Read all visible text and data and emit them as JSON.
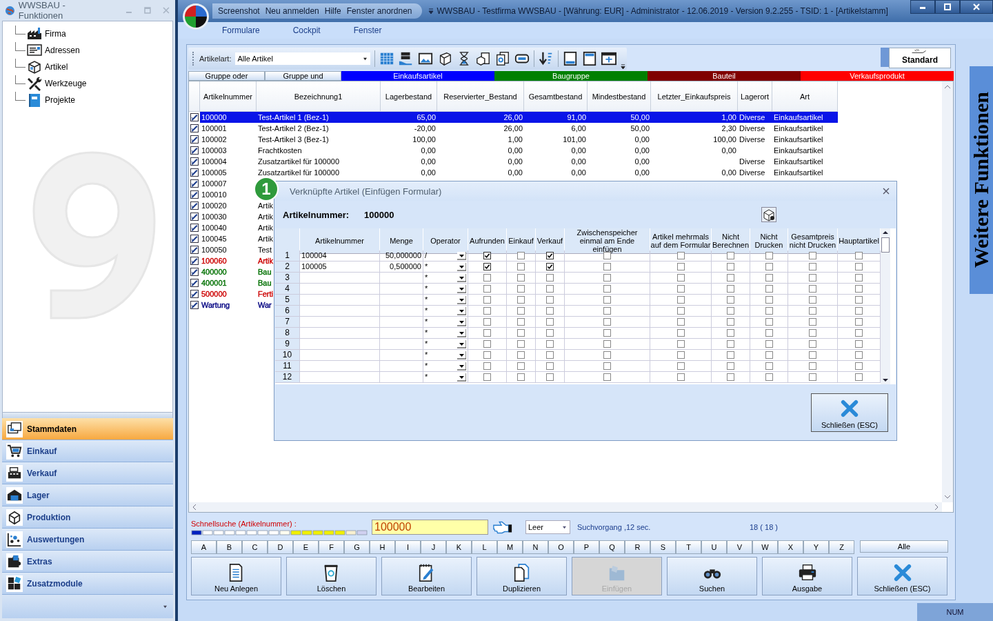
{
  "functions_window": {
    "title": "WWSBAU - Funktionen",
    "tree": [
      {
        "label": "Firma"
      },
      {
        "label": "Adressen"
      },
      {
        "label": "Artikel"
      },
      {
        "label": "Werkzeuge"
      },
      {
        "label": "Projekte"
      }
    ],
    "nav": [
      {
        "label": "Stammdaten",
        "selected": true
      },
      {
        "label": "Einkauf",
        "selected": false
      },
      {
        "label": "Verkauf",
        "selected": false
      },
      {
        "label": "Lager",
        "selected": false
      },
      {
        "label": "Produktion",
        "selected": false
      },
      {
        "label": "Auswertungen",
        "selected": false
      },
      {
        "label": "Extras",
        "selected": false
      },
      {
        "label": "Zusatzmodule",
        "selected": false
      }
    ]
  },
  "main_window": {
    "quick_menu": [
      "Screenshot",
      "Neu anmelden",
      "Hilfe",
      "Fenster anordnen"
    ],
    "title": "WWSBAU - Testfirma WWSBAU - [Währung: EUR] - Administrator - 12.06.2019 - Version 9.2.255 - TSID: 1 - [Artikelstamm]",
    "menu": [
      "Formulare",
      "Cockpit",
      "Fenster"
    ]
  },
  "toolbar": {
    "filter_label": "Artikelart:",
    "filter_value": "Alle Artikel",
    "view_button": "Standard"
  },
  "groups": [
    {
      "label": "Gruppe oder",
      "kind": "button"
    },
    {
      "label": "Gruppe und",
      "kind": "button"
    },
    {
      "label": "Einkaufsartikel",
      "kind": "band",
      "color": "#0000ff"
    },
    {
      "label": "Baugruppe",
      "kind": "band",
      "color": "#008000"
    },
    {
      "label": "Bauteil",
      "kind": "band",
      "color": "#800000"
    },
    {
      "label": "Verkaufsprodukt",
      "kind": "band",
      "color": "#ff0000"
    }
  ],
  "table": {
    "columns": [
      "Artikelnummer",
      "Bezeichnung1",
      "Lagerbestand",
      "Reservierter_Bestand",
      "Gesamtbestand",
      "Mindestbestand",
      "Letzter_Einkaufspreis",
      "Lagerort",
      "Art"
    ],
    "rows": [
      {
        "cells": [
          "100000",
          "Test-Artikel 1 (Bez-1)",
          "65,00",
          "26,00",
          "91,00",
          "50,00",
          "1,00",
          "Diverse",
          "Einkaufsartikel"
        ],
        "selected": true
      },
      {
        "cells": [
          "100001",
          "Test-Artikel 2 (Bez-1)",
          "-20,00",
          "26,00",
          "6,00",
          "50,00",
          "2,30",
          "Diverse",
          "Einkaufsartikel"
        ],
        "selected": false
      },
      {
        "cells": [
          "100002",
          "Test-Artikel 3 (Bez-1)",
          "100,00",
          "1,00",
          "101,00",
          "0,00",
          "100,00",
          "Diverse",
          "Einkaufsartikel"
        ],
        "selected": false
      },
      {
        "cells": [
          "100003",
          "Frachtkosten",
          "0,00",
          "0,00",
          "0,00",
          "0,00",
          "0,00",
          null,
          "Einkaufsartikel"
        ],
        "selected": false
      },
      {
        "cells": [
          "100004",
          "Zusatzartikel für 100000",
          "0,00",
          "0,00",
          "0,00",
          "0,00",
          null,
          "Diverse",
          "Einkaufsartikel"
        ],
        "selected": false
      },
      {
        "cells": [
          "100005",
          "Zusatzartikel für 100000",
          "0,00",
          "0,00",
          "0,00",
          "0,00",
          "0,00",
          "Diverse",
          "Einkaufsartikel"
        ],
        "selected": false
      },
      {
        "cells": [
          "100007"
        ],
        "selected": false
      },
      {
        "cells": [
          "100010"
        ],
        "selected": false
      },
      {
        "cells": [
          "100020",
          "Artik"
        ],
        "selected": false
      },
      {
        "cells": [
          "100030",
          "Artik"
        ],
        "selected": false
      },
      {
        "cells": [
          "100040",
          "Artik"
        ],
        "selected": false
      },
      {
        "cells": [
          "100045",
          "Artik"
        ],
        "selected": false
      },
      {
        "cells": [
          "100050",
          "Test"
        ],
        "selected": false
      },
      {
        "cells": [
          "100060",
          "Artik"
        ],
        "selected": false,
        "color": "#cc0000"
      },
      {
        "cells": [
          "400000",
          "Bau"
        ],
        "selected": false,
        "color": "#007000"
      },
      {
        "cells": [
          "400001",
          "Bau"
        ],
        "selected": false,
        "color": "#007000"
      },
      {
        "cells": [
          "500000",
          "Ferti"
        ],
        "selected": false,
        "color": "#cc0000"
      },
      {
        "cells": [
          "Wartung",
          "War"
        ],
        "selected": false,
        "color": "#000080"
      }
    ]
  },
  "side_tab": "Weitere Funktionen",
  "badge": "1",
  "dialog": {
    "title": "Verknüpfte Artikel (Einfügen Formular)",
    "label": "Artikelnummer:",
    "value": "100000",
    "columns": [
      "Artikelnummer",
      "Menge",
      "Operator",
      "Aufrunden",
      "Einkauf",
      "Verkauf",
      "Zwischenspeicher einmal am Ende einfügen",
      "Artikel mehrmals auf dem Formular",
      "Nicht Berechnen",
      "Nicht Drucken",
      "Gesamtpreis nicht Drucken",
      "Hauptartikel"
    ],
    "rows": [
      {
        "number": "1",
        "artikelnummer": "100004",
        "menge": "50,000000",
        "operator": "/",
        "flags": [
          true,
          false,
          true,
          false,
          false,
          false,
          false,
          false,
          false
        ]
      },
      {
        "number": "2",
        "artikelnummer": "100005",
        "menge": "0,500000",
        "operator": "*",
        "flags": [
          true,
          false,
          true,
          false,
          false,
          false,
          false,
          false,
          false
        ]
      },
      {
        "number": "3",
        "operator": "*",
        "flags": [
          false,
          false,
          false,
          false,
          false,
          false,
          false,
          false,
          false
        ]
      },
      {
        "number": "4",
        "operator": "*",
        "flags": [
          false,
          false,
          false,
          false,
          false,
          false,
          false,
          false,
          false
        ]
      },
      {
        "number": "5",
        "operator": "*",
        "flags": [
          false,
          false,
          false,
          false,
          false,
          false,
          false,
          false,
          false
        ]
      },
      {
        "number": "6",
        "operator": "*",
        "flags": [
          false,
          false,
          false,
          false,
          false,
          false,
          false,
          false,
          false
        ]
      },
      {
        "number": "7",
        "operator": "*",
        "flags": [
          false,
          false,
          false,
          false,
          false,
          false,
          false,
          false,
          false
        ]
      },
      {
        "number": "8",
        "operator": "*",
        "flags": [
          false,
          false,
          false,
          false,
          false,
          false,
          false,
          false,
          false
        ]
      },
      {
        "number": "9",
        "operator": "*",
        "flags": [
          false,
          false,
          false,
          false,
          false,
          false,
          false,
          false,
          false
        ]
      },
      {
        "number": "10",
        "operator": "*",
        "flags": [
          false,
          false,
          false,
          false,
          false,
          false,
          false,
          false,
          false
        ]
      },
      {
        "number": "11",
        "operator": "*",
        "flags": [
          false,
          false,
          false,
          false,
          false,
          false,
          false,
          false,
          false
        ]
      },
      {
        "number": "12",
        "operator": "*",
        "flags": [
          false,
          false,
          false,
          false,
          false,
          false,
          false,
          false,
          false
        ]
      }
    ],
    "close_button": "Schließen (ESC)"
  },
  "search": {
    "label": "Schnellsuche (Artikelnummer) :",
    "value": "100000",
    "mode": "Leer",
    "duration": "Suchvorgang ,12 sec.",
    "count": "18 ( 18 )"
  },
  "letters": [
    "A",
    "B",
    "C",
    "D",
    "E",
    "F",
    "G",
    "H",
    "I",
    "J",
    "K",
    "L",
    "M",
    "N",
    "O",
    "P",
    "Q",
    "R",
    "S",
    "T",
    "U",
    "V",
    "W",
    "X",
    "Y",
    "Z"
  ],
  "all_button": "Alle",
  "actions": [
    {
      "label": "Neu Anlegen",
      "disabled": false
    },
    {
      "label": "Löschen",
      "disabled": false
    },
    {
      "label": "Bearbeiten",
      "disabled": false
    },
    {
      "label": "Duplizieren",
      "disabled": false
    },
    {
      "label": "Einfügen",
      "disabled": true
    },
    {
      "label": "Suchen",
      "disabled": false
    },
    {
      "label": "Ausgabe",
      "disabled": false
    },
    {
      "label": "Schließen (ESC)",
      "disabled": false
    }
  ],
  "status_bar": {
    "indicator": "NUM"
  }
}
